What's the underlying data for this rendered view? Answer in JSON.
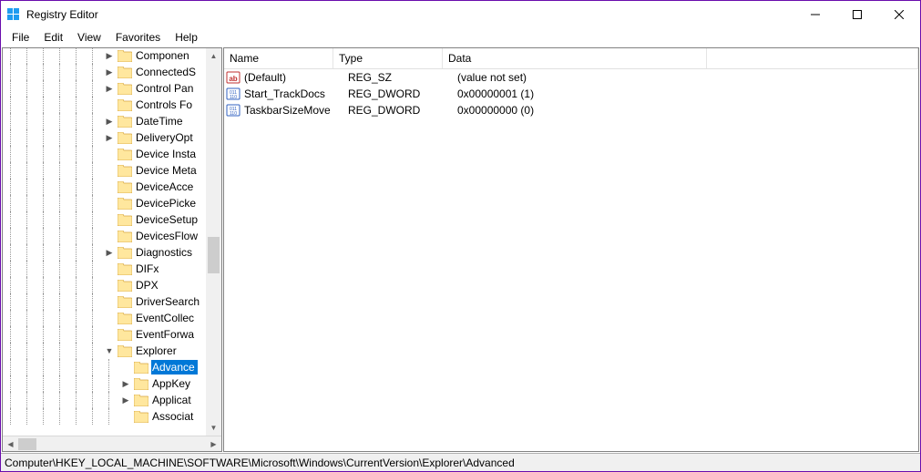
{
  "window": {
    "title": "Registry Editor"
  },
  "menu": {
    "file": "File",
    "edit": "Edit",
    "view": "View",
    "favorites": "Favorites",
    "help": "Help"
  },
  "tree": {
    "items": [
      {
        "indent": 6,
        "expand": ">",
        "label": "Componen"
      },
      {
        "indent": 6,
        "expand": ">",
        "label": "ConnectedS"
      },
      {
        "indent": 6,
        "expand": ">",
        "label": "Control Pan"
      },
      {
        "indent": 6,
        "expand": "",
        "label": "Controls Fo"
      },
      {
        "indent": 6,
        "expand": ">",
        "label": "DateTime"
      },
      {
        "indent": 6,
        "expand": ">",
        "label": "DeliveryOpt"
      },
      {
        "indent": 6,
        "expand": "",
        "label": "Device Insta"
      },
      {
        "indent": 6,
        "expand": "",
        "label": "Device Meta"
      },
      {
        "indent": 6,
        "expand": "",
        "label": "DeviceAcce"
      },
      {
        "indent": 6,
        "expand": "",
        "label": "DevicePicke"
      },
      {
        "indent": 6,
        "expand": "",
        "label": "DeviceSetup"
      },
      {
        "indent": 6,
        "expand": "",
        "label": "DevicesFlow"
      },
      {
        "indent": 6,
        "expand": ">",
        "label": "Diagnostics"
      },
      {
        "indent": 6,
        "expand": "",
        "label": "DIFx"
      },
      {
        "indent": 6,
        "expand": "",
        "label": "DPX"
      },
      {
        "indent": 6,
        "expand": "",
        "label": "DriverSearch"
      },
      {
        "indent": 6,
        "expand": "",
        "label": "EventCollec"
      },
      {
        "indent": 6,
        "expand": "",
        "label": "EventForwa"
      },
      {
        "indent": 6,
        "expand": "v",
        "label": "Explorer"
      },
      {
        "indent": 7,
        "expand": "",
        "label": "Advance",
        "selected": true
      },
      {
        "indent": 7,
        "expand": ">",
        "label": "AppKey"
      },
      {
        "indent": 7,
        "expand": ">",
        "label": "Applicat"
      },
      {
        "indent": 7,
        "expand": "",
        "label": "Associat"
      }
    ]
  },
  "list": {
    "header": {
      "name": "Name",
      "type": "Type",
      "data": "Data"
    },
    "rows": [
      {
        "icon": "ab",
        "name": "(Default)",
        "type": "REG_SZ",
        "data": "(value not set)"
      },
      {
        "icon": "bin",
        "name": "Start_TrackDocs",
        "type": "REG_DWORD",
        "data": "0x00000001 (1)"
      },
      {
        "icon": "bin",
        "name": "TaskbarSizeMove",
        "type": "REG_DWORD",
        "data": "0x00000000 (0)"
      }
    ]
  },
  "statusbar": {
    "path": "Computer\\HKEY_LOCAL_MACHINE\\SOFTWARE\\Microsoft\\Windows\\CurrentVersion\\Explorer\\Advanced"
  }
}
